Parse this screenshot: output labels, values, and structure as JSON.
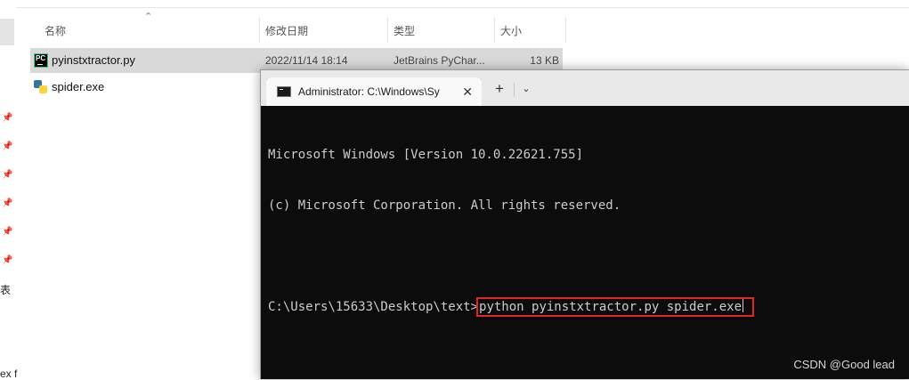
{
  "explorer": {
    "columns": {
      "name": "名称",
      "modified": "修改日期",
      "type": "类型",
      "size": "大小"
    },
    "rows": [
      {
        "name": "pyinstxtractor.py",
        "modified": "2022/11/14 18:14",
        "type": "JetBrains PyChar...",
        "size": "13 KB",
        "icon": "pycharm-file-icon",
        "selected": true
      },
      {
        "name": "spider.exe",
        "modified": "",
        "type": "",
        "size": "",
        "icon": "python-exe-icon",
        "selected": false
      }
    ],
    "nav_fragments": [
      "表",
      "ex f"
    ]
  },
  "terminal": {
    "tab_title": "Administrator: C:\\Windows\\Sy",
    "close_glyph": "✕",
    "new_tab_glyph": "+",
    "dropdown_glyph": "⌄",
    "lines": [
      "Microsoft Windows [Version 10.0.22621.755]",
      "(c) Microsoft Corporation. All rights reserved."
    ],
    "prompt": "C:\\Users\\15633\\Desktop\\text>",
    "command": "python pyinstxtractor.py spider.exe",
    "highlight_color": "#e0261e",
    "background_color": "#0c0c0c"
  },
  "watermark": "CSDN @Good lead"
}
